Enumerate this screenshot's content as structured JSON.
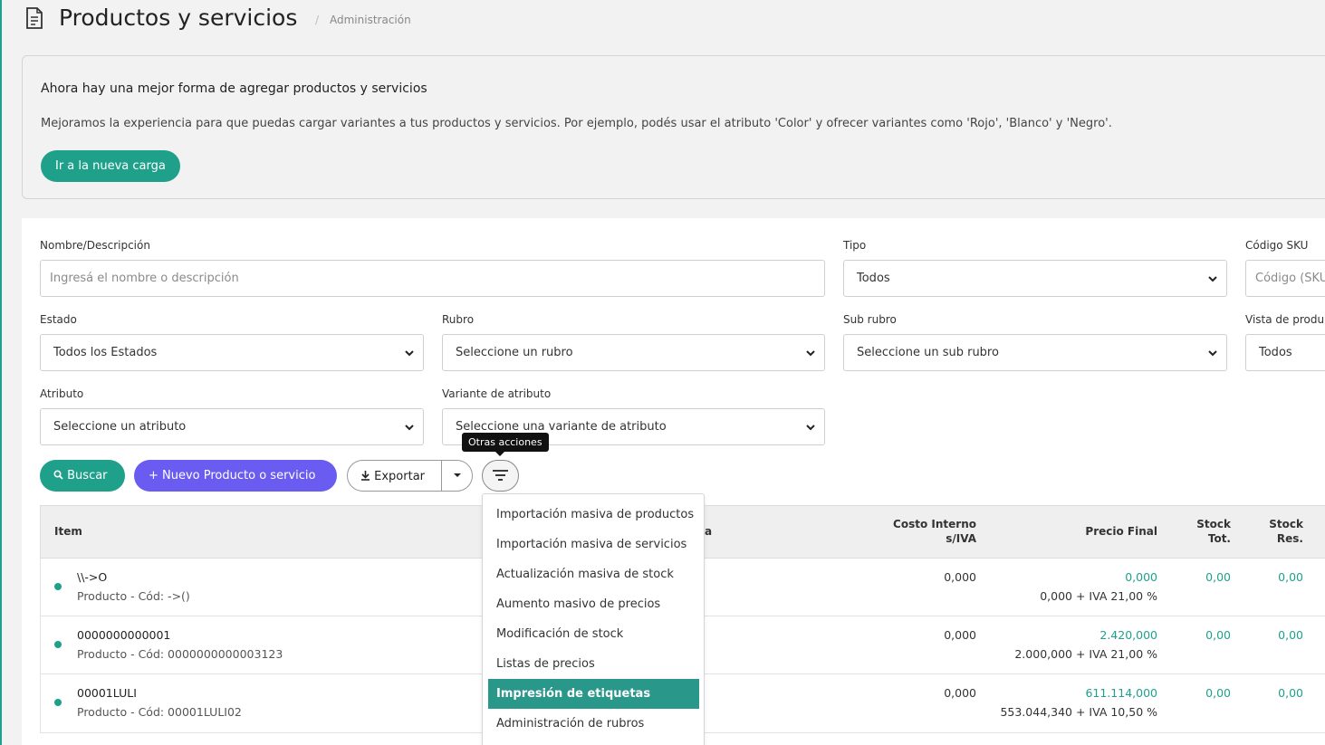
{
  "header": {
    "title": "Productos y servicios",
    "breadcrumb_sep": "/",
    "breadcrumb": "Administración"
  },
  "banner": {
    "title": "Ahora hay una mejor forma de agregar productos y servicios",
    "text": "Mejoramos la experiencia para que puedas cargar variantes a tus productos y servicios. Por ejemplo, podés usar el atributo 'Color' y ofrecer variantes como 'Rojo', 'Blanco' y 'Negro'.",
    "button": "Ir a la nueva carga"
  },
  "filters": {
    "nombre_label": "Nombre/Descripción",
    "nombre_placeholder": "Ingresá el nombre o descripción",
    "tipo_label": "Tipo",
    "tipo_value": "Todos",
    "sku_label": "Código SKU",
    "sku_placeholder": "Código (SKU",
    "estado_label": "Estado",
    "estado_value": "Todos los Estados",
    "rubro_label": "Rubro",
    "rubro_value": "Seleccione un rubro",
    "subrubro_label": "Sub rubro",
    "subrubro_value": "Seleccione un sub rubro",
    "vista_label": "Vista de produ",
    "vista_value": "Todos",
    "atributo_label": "Atributo",
    "atributo_value": "Seleccione un atributo",
    "variante_label": "Variante de atributo",
    "variante_value": "Seleccione una variante de atributo"
  },
  "actions": {
    "buscar": "Buscar",
    "nuevo": "+ Nuevo Producto o servicio",
    "exportar": "Exportar",
    "tooltip": "Otras acciones"
  },
  "menu": {
    "items": [
      "Importación masiva de productos",
      "Importación masiva de servicios",
      "Actualización masiva de stock",
      "Aumento masivo de precios",
      "Modificación de stock",
      "Listas de precios",
      "Impresión de etiquetas",
      "Administración de rubros"
    ],
    "active_index": 6
  },
  "table": {
    "headers": {
      "item": "Item",
      "hidden_partial": "a",
      "costo_1": "Costo Interno",
      "costo_2": "s/IVA",
      "precio": "Precio Final",
      "stock_tot_1": "Stock",
      "stock_tot_2": "Tot.",
      "stock_res_1": "Stock",
      "stock_res_2": "Res."
    },
    "rows": [
      {
        "name": "\\\\->O",
        "sub": "Producto - Cód: ->()",
        "costo": "0,000",
        "precio": "0,000",
        "precio_detalle": "0,000 + IVA 21,00 %",
        "stock_tot": "0,00",
        "stock_res": "0,00"
      },
      {
        "name": "0000000000001",
        "sub": "Producto - Cód: 0000000000003123",
        "costo": "0,000",
        "precio": "2.420,000",
        "precio_detalle": "2.000,000 + IVA 21,00 %",
        "stock_tot": "0,00",
        "stock_res": "0,00"
      },
      {
        "name": "00001LULI",
        "sub": "Producto - Cód: 00001LULI02",
        "costo": "0,000",
        "precio": "611.114,000",
        "precio_detalle": "553.044,340 + IVA 10,50 %",
        "stock_tot": "0,00",
        "stock_res": "0,00"
      }
    ]
  },
  "colors": {
    "accent": "#1fa08a",
    "primary": "#6a5cf0",
    "menu_active": "#299789"
  }
}
